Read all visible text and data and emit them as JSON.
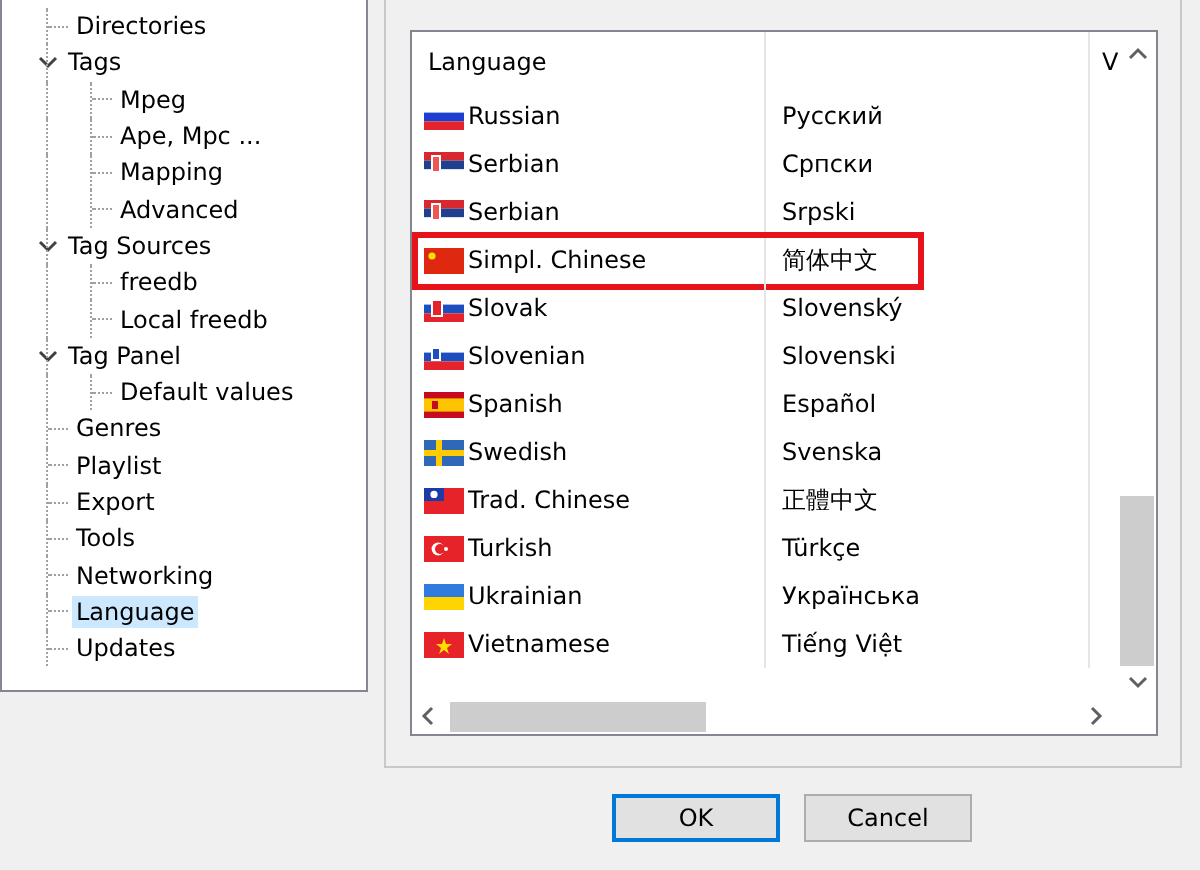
{
  "tree": [
    {
      "label": "Directories",
      "selected": false
    },
    {
      "label": "Tags",
      "expanded": true,
      "selected": false,
      "children": [
        {
          "label": "Mpeg",
          "selected": false
        },
        {
          "label": "Ape, Mpc ...",
          "selected": false
        },
        {
          "label": "Mapping",
          "selected": false
        },
        {
          "label": "Advanced",
          "selected": false
        }
      ]
    },
    {
      "label": "Tag Sources",
      "expanded": true,
      "selected": false,
      "children": [
        {
          "label": "freedb",
          "selected": false
        },
        {
          "label": "Local freedb",
          "selected": false
        }
      ]
    },
    {
      "label": "Tag Panel",
      "expanded": true,
      "selected": false,
      "children": [
        {
          "label": "Default values",
          "selected": false
        }
      ]
    },
    {
      "label": "Genres",
      "selected": false
    },
    {
      "label": "Playlist",
      "selected": false
    },
    {
      "label": "Export",
      "selected": false
    },
    {
      "label": "Tools",
      "selected": false
    },
    {
      "label": "Networking",
      "selected": false
    },
    {
      "label": "Language",
      "selected": true
    },
    {
      "label": "Updates",
      "selected": false
    }
  ],
  "language_list": {
    "columns": [
      "Language",
      "",
      "V"
    ],
    "rows": [
      {
        "kind": "ru",
        "name": "Russian",
        "native": "Русский",
        "highlighted": false
      },
      {
        "kind": "rs",
        "name": "Serbian",
        "native": "Српски",
        "highlighted": false
      },
      {
        "kind": "rs",
        "name": "Serbian",
        "native": "Srpski",
        "highlighted": false
      },
      {
        "kind": "cn",
        "name": "Simpl. Chinese",
        "native": "简体中文",
        "highlighted": true
      },
      {
        "kind": "sk",
        "name": "Slovak",
        "native": "Slovenský",
        "highlighted": false
      },
      {
        "kind": "si",
        "name": "Slovenian",
        "native": "Slovenski",
        "highlighted": false
      },
      {
        "kind": "es",
        "name": "Spanish",
        "native": "Español",
        "highlighted": false
      },
      {
        "kind": "se",
        "name": "Swedish",
        "native": "Svenska",
        "highlighted": false
      },
      {
        "kind": "tw",
        "name": "Trad. Chinese",
        "native": "正體中文",
        "highlighted": false
      },
      {
        "kind": "tr",
        "name": "Turkish",
        "native": "Türkçe",
        "highlighted": false
      },
      {
        "kind": "ua",
        "name": "Ukrainian",
        "native": "Українська",
        "highlighted": false
      },
      {
        "kind": "vn",
        "name": "Vietnamese",
        "native": "Tiếng Việt",
        "highlighted": false
      }
    ]
  },
  "buttons": [
    "OK",
    "Cancel"
  ]
}
